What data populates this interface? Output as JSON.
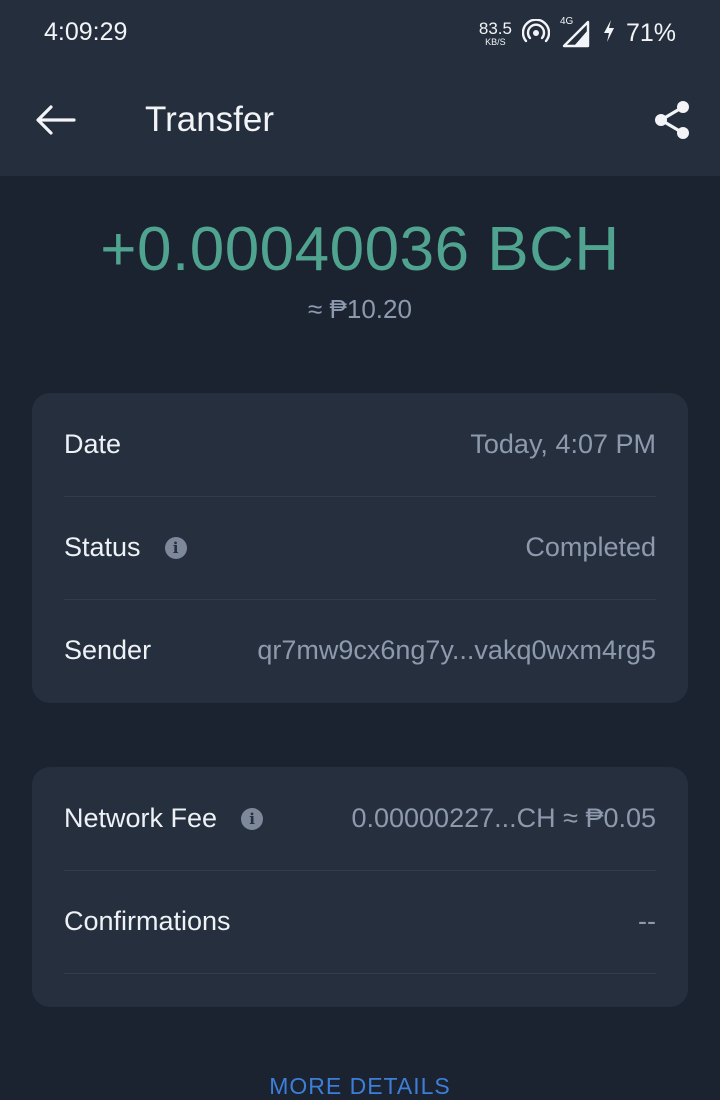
{
  "status_bar": {
    "time": "4:09:29",
    "net_speed": "83.5",
    "net_unit": "KB/S",
    "network_type": "4G",
    "battery": "71%"
  },
  "app_bar": {
    "title": "Transfer"
  },
  "transaction": {
    "amount": "+0.00040036 BCH",
    "fiat": "≈ ₱10.20"
  },
  "details": [
    {
      "label": "Date",
      "value": "Today, 4:07 PM"
    },
    {
      "label": "Status",
      "value": "Completed"
    },
    {
      "label": "Sender",
      "value": "qr7mw9cx6ng7y...vakq0wxm4rg5"
    }
  ],
  "fees": [
    {
      "label": "Network Fee",
      "value": "0.00000227...CH ≈ ₱0.05"
    },
    {
      "label": "Confirmations",
      "value": "--"
    }
  ],
  "more_details_label": "MORE DETAILS",
  "colors": {
    "background": "#1b2230",
    "surface": "#262f3d",
    "accent_green": "#4fa38f",
    "muted_text": "#8d9aae",
    "link_blue": "#3d7fd8"
  },
  "icons": {
    "back": "arrow-left-icon",
    "share": "share-icon",
    "info": "info-icon",
    "hotspot": "hotspot-icon",
    "signal": "signal-icon",
    "charging": "charging-icon"
  }
}
